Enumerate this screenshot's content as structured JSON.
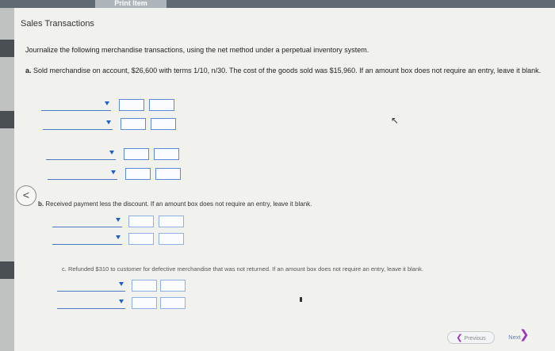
{
  "window": {
    "tab_label": "Print Item"
  },
  "section": {
    "title": "Sales Transactions"
  },
  "instructions": "Journalize the following merchandise transactions, using the net method under a perpetual inventory system.",
  "question_a": {
    "label": "a.",
    "text": "Sold merchandise on account, $26,600 with terms 1/10, n/30. The cost of the goods sold was $15,960. If an amount box does not require an entry, leave it blank."
  },
  "question_b": {
    "label": "b.",
    "text": "Received payment less the discount. If an amount box does not require an entry, leave it blank."
  },
  "question_c": {
    "label": "c.",
    "text": "Refunded $310 to customer for defective merchandise that was not returned. If an amount box does not require an entry, leave it blank."
  },
  "navigation": {
    "prev_circle": "<",
    "prev_label": "Previous",
    "next_label": "Next"
  },
  "colors": {
    "accent": "#1d5fcc",
    "nav_chevron": "#9b36b8"
  }
}
